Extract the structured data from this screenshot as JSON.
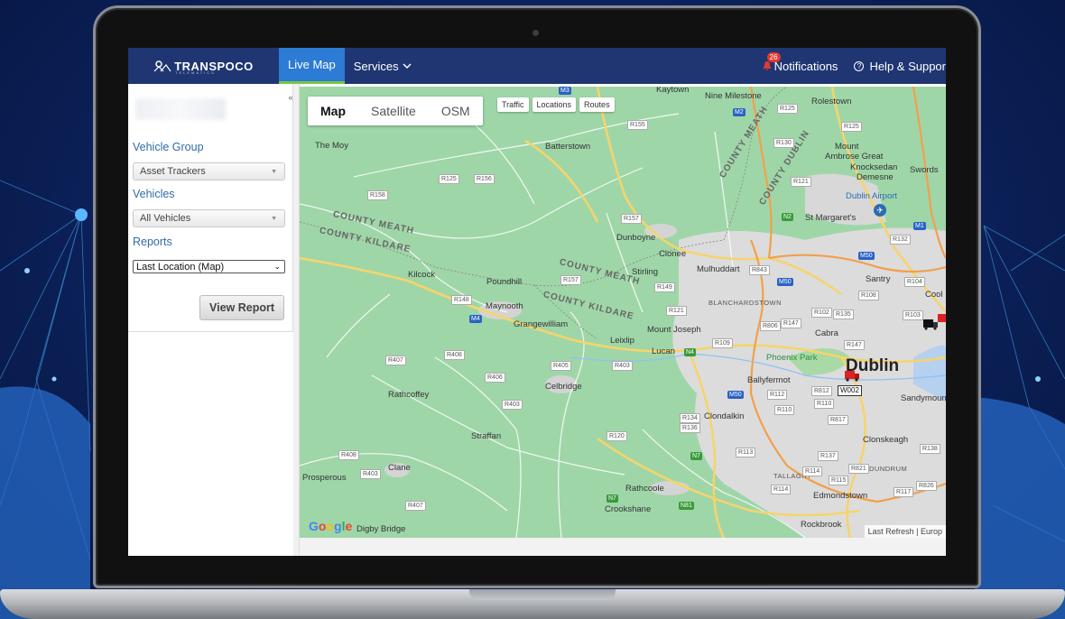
{
  "header": {
    "brand": "TRANSPOCO",
    "brand_sub": "TELEMATICS",
    "nav_live": "Live Map",
    "nav_services": "Services",
    "notifications_count": "26",
    "notifications_label": "Notifications",
    "help_label": "Help & Suppor"
  },
  "sidebar": {
    "vehicle_group_label": "Vehicle Group",
    "vehicle_group_value": "Asset Trackers",
    "vehicles_label": "Vehicles",
    "vehicles_value": "All Vehicles",
    "reports_label": "Reports",
    "reports_value": "Last Location (Map)",
    "view_report": "View Report",
    "collapse": "«"
  },
  "map": {
    "types": [
      "Map",
      "Satellite",
      "OSM"
    ],
    "active_type": "Map",
    "layers": [
      "Traffic",
      "Locations",
      "Routes"
    ],
    "last_refresh": "Last Refresh",
    "europe_cut": "| Europ",
    "google": [
      "G",
      "o",
      "o",
      "g",
      "l",
      "e"
    ],
    "vehicle_label": "W002",
    "places": {
      "kaytown": "Kaytown",
      "nine_milestone": "Nine Milestone",
      "rolestown": "Rolestown",
      "the_moy": "The Moy",
      "batterstown": "Batterstown",
      "mount_ambrose": "Mount",
      "ambrose_great": "Ambrose Great",
      "knocksedan": "Knocksedan",
      "demesne": "Demesne",
      "swords": "Swords",
      "dublin_airport": "Dublin Airport",
      "st_margarets": "St Margaret's",
      "dunboyne": "Dunboyne",
      "clonee": "Clonee",
      "kilcock": "Kilcock",
      "stirling": "Stirling",
      "mulhuddart": "Mulhuddart",
      "santry": "Santry",
      "coolo": "Cool",
      "poundhill": "Poundhill",
      "maynooth": "Maynooth",
      "blanchardstown": "BLANCHARDSTOWN",
      "grangewilliam": "Grangewilliam",
      "mount_joseph": "Mount Joseph",
      "leixlip": "Leixlip",
      "cabra": "Cabra",
      "lucan": "Lucan",
      "phoenix_park": "Phoenix Park",
      "dublin": "Dublin",
      "ballyfermot": "Ballyfermot",
      "celbridge": "Celbridge",
      "rathcoffey": "Rathcoffey",
      "sandymount": "Sandymoun",
      "clondalkin": "Clondalkin",
      "straffan": "Straffan",
      "clonskeagh": "Clonskeagh",
      "clane": "Clane",
      "prosperous": "Prosperous",
      "tallaght": "TALLAGHT",
      "dundrum": "DUNDRUM",
      "rathcoole": "Rathcoole",
      "edmondstown": "Edmondstown",
      "crookshane": "Crookshane",
      "digby_bridge": "Digby Bridge",
      "rockbrook": "Rockbrook"
    },
    "counties": {
      "meath_dublin1": "COUNTY MEATH",
      "dublin_n": "COUNTY DUBLIN",
      "meath_w": "COUNTY MEATH",
      "kildare_w": "COUNTY KILDARE",
      "meath_c": "COUNTY MEATH",
      "kildare_c": "COUNTY KILDARE"
    },
    "roads": {
      "r125a": "R125",
      "r125b": "R125",
      "r155": "R155",
      "r130": "R130",
      "r125c": "R125",
      "r156": "R156",
      "r121": "R121",
      "r158": "R158",
      "r157a": "R157",
      "r132": "R132",
      "m50a": "M50",
      "r843": "R843",
      "r157b": "R157",
      "r149": "R149",
      "m50b": "M50",
      "r104": "R104",
      "r148": "R148",
      "r108": "R108",
      "r121b": "R121",
      "r102": "R102",
      "r135": "R135",
      "r103": "R103",
      "r806": "R806",
      "r147a": "R147",
      "r109": "R109",
      "r147b": "R147",
      "r407a": "R407",
      "r408a": "R408",
      "r405": "R405",
      "r403a": "R403",
      "r406": "R406",
      "m50c": "M50",
      "r112": "R112",
      "r812": "R812",
      "r110a": "R110",
      "r403b": "R403",
      "r134": "R134",
      "r136": "R136",
      "r110b": "R110",
      "r817": "R817",
      "r120": "R120",
      "r138": "R138",
      "r113": "R113",
      "r137": "R137",
      "r408b": "R408",
      "r403c": "R403",
      "r114a": "R114",
      "r821": "R821",
      "r115": "R115",
      "r826": "R826",
      "r114b": "R114",
      "r117": "R117",
      "r407b": "R407",
      "m3": "M3",
      "m2": "M2",
      "m1": "M1",
      "m4": "M4",
      "n2": "N2",
      "n4": "N4",
      "n7a": "N7",
      "n7b": "N7",
      "n81": "N81"
    }
  }
}
